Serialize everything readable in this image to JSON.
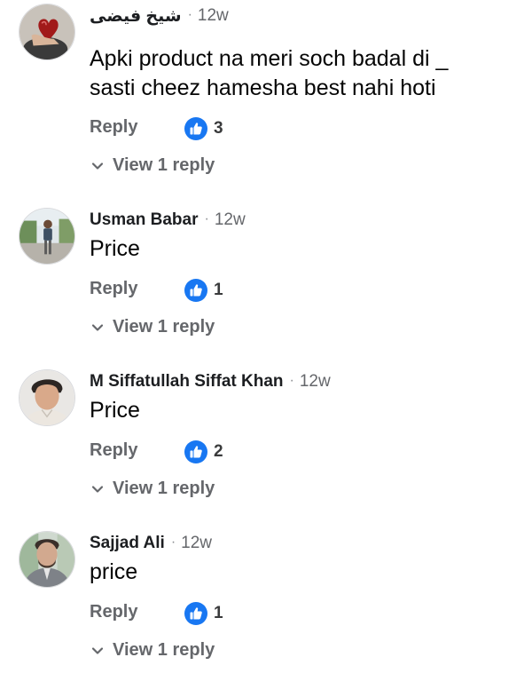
{
  "comments": [
    {
      "author": "شیخ فیضی",
      "time": "12w",
      "text": "Apki product na meri soch badal di _ sasti cheez hamesha best nahi hoti",
      "reply_label": "Reply",
      "likes": "3",
      "view_replies": "View 1 reply",
      "avatar_icon": "red-heart-in-hand-photo"
    },
    {
      "author": "Usman Babar",
      "time": "12w",
      "text": "Price",
      "reply_label": "Reply",
      "likes": "1",
      "view_replies": "View 1 reply",
      "avatar_icon": "outdoor-standing-person-photo"
    },
    {
      "author": "M Siffatullah Siffat Khan",
      "time": "12w",
      "text": "Price",
      "reply_label": "Reply",
      "likes": "2",
      "view_replies": "View 1 reply",
      "avatar_icon": "man-portrait-photo"
    },
    {
      "author": "Sajjad Ali",
      "time": "12w",
      "text": "price",
      "reply_label": "Reply",
      "likes": "1",
      "view_replies": "View 1 reply",
      "avatar_icon": "man-in-grey-suit-photo"
    }
  ],
  "colors": {
    "like_blue": "#1877f2",
    "secondary_text": "#65676b"
  }
}
